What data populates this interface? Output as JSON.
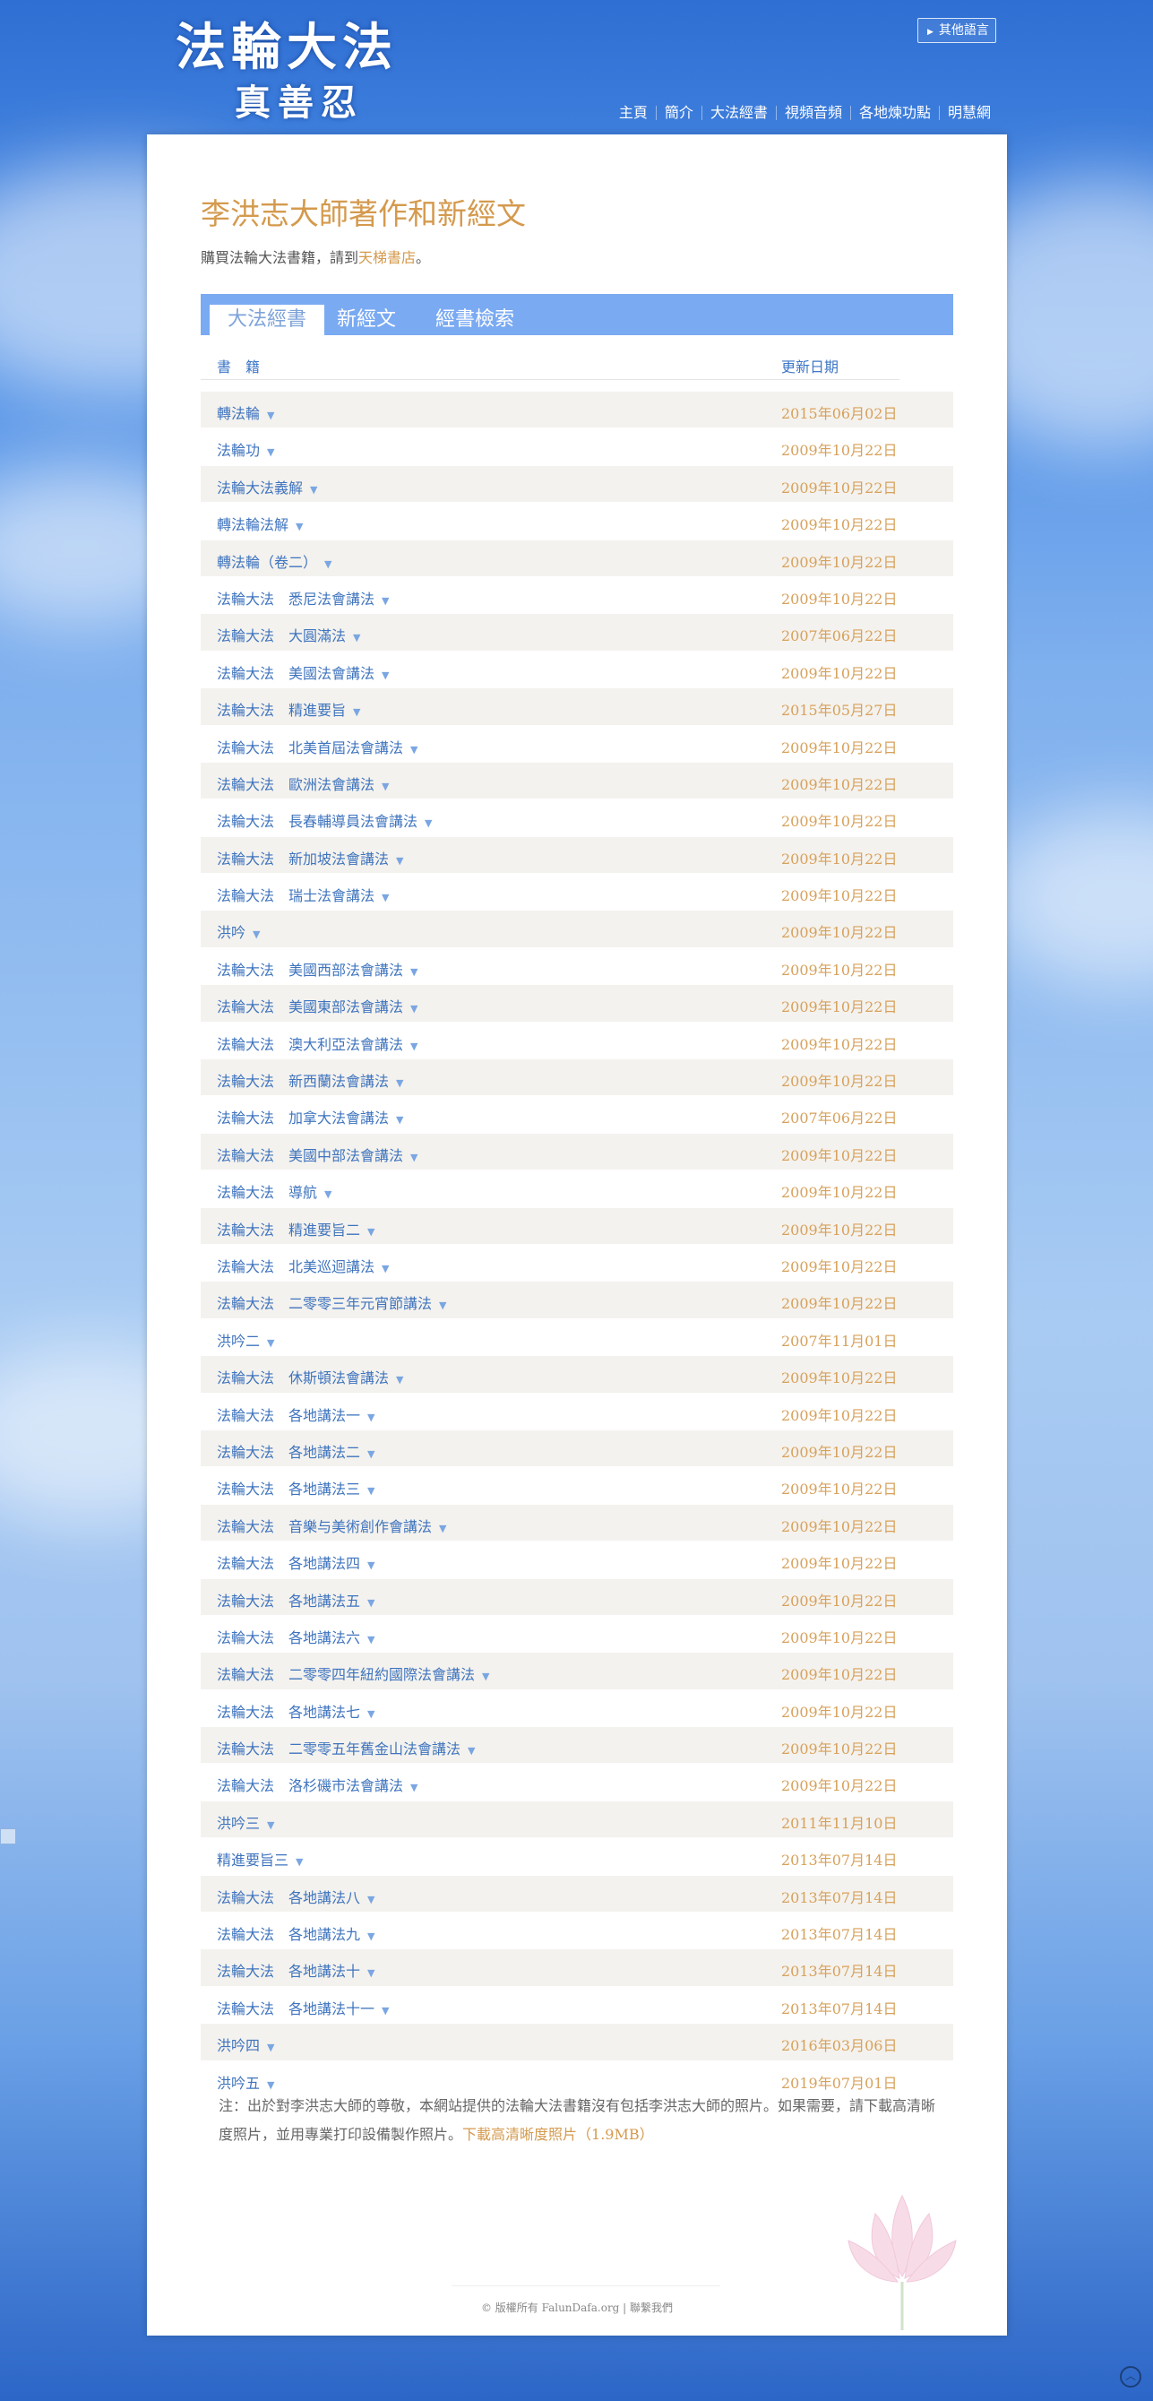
{
  "header": {
    "logo_title": "法輪大法",
    "logo_subtitle": "真善忍",
    "language_button": "其他語言",
    "nav": [
      "主頁",
      "簡介",
      "大法經書",
      "視頻音頻",
      "各地煉功點",
      "明慧網"
    ]
  },
  "main": {
    "title": "李洪志大師著作和新經文",
    "buy_prefix": "購買法輪大法書籍，請到",
    "buy_link": "天梯書店",
    "buy_suffix": "。",
    "tabs": [
      "大法經書",
      "新經文",
      "經書檢索"
    ],
    "columns": {
      "book": "書　籍",
      "updated": "更新日期"
    },
    "books": [
      {
        "name": "轉法輪",
        "date": "2015年06月02日"
      },
      {
        "name": "法輪功",
        "date": "2009年10月22日"
      },
      {
        "name": "法輪大法義解",
        "date": "2009年10月22日"
      },
      {
        "name": "轉法輪法解",
        "date": "2009年10月22日"
      },
      {
        "name": "轉法輪（卷二）",
        "date": "2009年10月22日"
      },
      {
        "name": "法輪大法　悉尼法會講法",
        "date": "2009年10月22日"
      },
      {
        "name": "法輪大法　大圓滿法",
        "date": "2007年06月22日"
      },
      {
        "name": "法輪大法　美國法會講法",
        "date": "2009年10月22日"
      },
      {
        "name": "法輪大法　精進要旨",
        "date": "2015年05月27日"
      },
      {
        "name": "法輪大法　北美首屆法會講法",
        "date": "2009年10月22日"
      },
      {
        "name": "法輪大法　歐洲法會講法",
        "date": "2009年10月22日"
      },
      {
        "name": "法輪大法　長春輔導員法會講法",
        "date": "2009年10月22日"
      },
      {
        "name": "法輪大法　新加坡法會講法",
        "date": "2009年10月22日"
      },
      {
        "name": "法輪大法　瑞士法會講法",
        "date": "2009年10月22日"
      },
      {
        "name": "洪吟",
        "date": "2009年10月22日"
      },
      {
        "name": "法輪大法　美國西部法會講法",
        "date": "2009年10月22日"
      },
      {
        "name": "法輪大法　美國東部法會講法",
        "date": "2009年10月22日"
      },
      {
        "name": "法輪大法　澳大利亞法會講法",
        "date": "2009年10月22日"
      },
      {
        "name": "法輪大法　新西蘭法會講法",
        "date": "2009年10月22日"
      },
      {
        "name": "法輪大法　加拿大法會講法",
        "date": "2007年06月22日"
      },
      {
        "name": "法輪大法　美國中部法會講法",
        "date": "2009年10月22日"
      },
      {
        "name": "法輪大法　導航",
        "date": "2009年10月22日"
      },
      {
        "name": "法輪大法　精進要旨二",
        "date": "2009年10月22日"
      },
      {
        "name": "法輪大法　北美巡迴講法",
        "date": "2009年10月22日"
      },
      {
        "name": "法輪大法　二零零三年元宵節講法",
        "date": "2009年10月22日"
      },
      {
        "name": "洪吟二",
        "date": "2007年11月01日"
      },
      {
        "name": "法輪大法　休斯頓法會講法",
        "date": "2009年10月22日"
      },
      {
        "name": "法輪大法　各地講法一",
        "date": "2009年10月22日"
      },
      {
        "name": "法輪大法　各地講法二",
        "date": "2009年10月22日"
      },
      {
        "name": "法輪大法　各地講法三",
        "date": "2009年10月22日"
      },
      {
        "name": "法輪大法　音樂与美術創作會講法",
        "date": "2009年10月22日"
      },
      {
        "name": "法輪大法　各地講法四",
        "date": "2009年10月22日"
      },
      {
        "name": "法輪大法　各地講法五",
        "date": "2009年10月22日"
      },
      {
        "name": "法輪大法　各地講法六",
        "date": "2009年10月22日"
      },
      {
        "name": "法輪大法　二零零四年紐約國際法會講法",
        "date": "2009年10月22日"
      },
      {
        "name": "法輪大法　各地講法七",
        "date": "2009年10月22日"
      },
      {
        "name": "法輪大法　二零零五年舊金山法會講法",
        "date": "2009年10月22日"
      },
      {
        "name": "法輪大法　洛杉磯市法會講法",
        "date": "2009年10月22日"
      },
      {
        "name": "洪吟三",
        "date": "2011年11月10日"
      },
      {
        "name": "精進要旨三",
        "date": "2013年07月14日"
      },
      {
        "name": "法輪大法　各地講法八",
        "date": "2013年07月14日"
      },
      {
        "name": "法輪大法　各地講法九",
        "date": "2013年07月14日"
      },
      {
        "name": "法輪大法　各地講法十",
        "date": "2013年07月14日"
      },
      {
        "name": "法輪大法　各地講法十一",
        "date": "2013年07月14日"
      },
      {
        "name": "洪吟四",
        "date": "2016年03月06日"
      },
      {
        "name": "洪吟五",
        "date": "2019年07月01日"
      }
    ],
    "note_text": "注：出於對李洪志大師的尊敬，本網站提供的法輪大法書籍沒有包括李洪志大師的照片。如果需要，請下載高清晰度照片，並用專業打印設備製作照片。",
    "note_link": "下載高清晰度照片（1.9MB）"
  },
  "footer": {
    "copyright": "© 版權所有 FalunDafa.org",
    "separator": " | ",
    "contact": "聯繫我們"
  },
  "icons": {
    "caret": "chevron-down-icon",
    "language": "caret-right-icon",
    "scroll_top": "chevron-up-icon"
  },
  "colors": {
    "accent_orange": "#d49a4e",
    "link_blue": "#3f74be",
    "tab_bar": "#7aaaf2"
  }
}
